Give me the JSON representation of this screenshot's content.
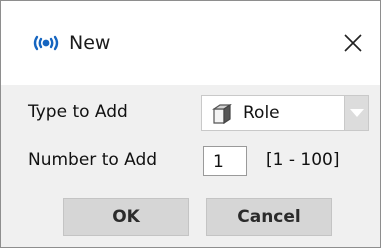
{
  "dialog": {
    "title": "New",
    "icon": "network-eye-icon",
    "close_icon": "close-icon"
  },
  "form": {
    "type_label": "Type to Add",
    "type_value": "Role",
    "type_icon": "cube-icon",
    "number_label": "Number to Add",
    "number_value": "1",
    "number_range": "[1 - 100]"
  },
  "buttons": {
    "ok_label": "OK",
    "cancel_label": "Cancel"
  },
  "colors": {
    "accent_blue": "#1565c0",
    "dialog_background": "#f0f0f0",
    "button_background": "#d6d6d6"
  }
}
